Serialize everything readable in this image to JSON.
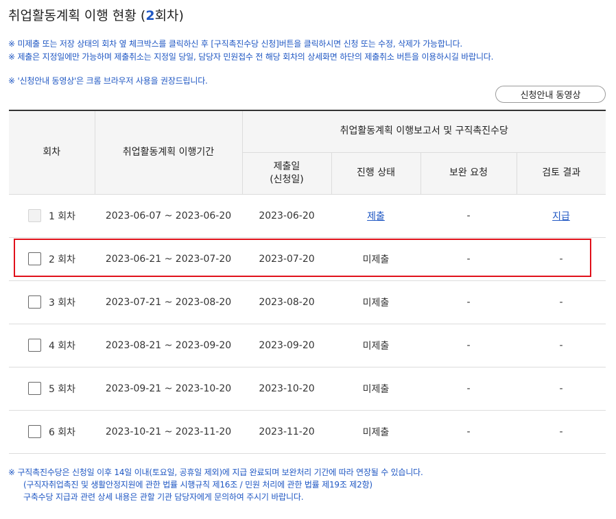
{
  "page": {
    "title_main": "취업활동계획 이행 현황 (",
    "title_round": "2",
    "title_suffix": "회차)"
  },
  "notices": {
    "line1": "※ 미제출 또는 저장 상태의 회차 옆 체크박스를 클릭하신 후 [구직촉진수당 신청]버튼을 클릭하시면 신청 또는 수정, 삭제가 가능합니다.",
    "line2": "※ 제출은 지정일에만 가능하며 제출취소는 지정일 당일, 담당자 민원접수 전 해당 회차의 상세화면 하단의 제출취소 버튼을 이용하시길 바랍니다.",
    "line3": "※ '신청안내 동영상'은 크롬 브라우저 사용을 권장드립니다."
  },
  "video_button": "신청안내 동영상",
  "table": {
    "headers": {
      "round": "회차",
      "period": "취업활동계획 이행기간",
      "group": "취업활동계획 이행보고서 및 구직촉진수당",
      "submit_line1": "제출일",
      "submit_line2": "(신청일)",
      "status": "진행 상태",
      "supplement": "보완 요청",
      "review": "검토 결과"
    },
    "rows": [
      {
        "round": "1 회차",
        "period": "2023-06-07 ~ 2023-06-20",
        "date": "2023-06-20",
        "status": "제출",
        "supplement": "-",
        "review": "지급"
      },
      {
        "round": "2 회차",
        "period": "2023-06-21 ~ 2023-07-20",
        "date": "2023-07-20",
        "status": "미제출",
        "supplement": "-",
        "review": "-"
      },
      {
        "round": "3 회차",
        "period": "2023-07-21 ~ 2023-08-20",
        "date": "2023-08-20",
        "status": "미제출",
        "supplement": "-",
        "review": "-"
      },
      {
        "round": "4 회차",
        "period": "2023-08-21 ~ 2023-09-20",
        "date": "2023-09-20",
        "status": "미제출",
        "supplement": "-",
        "review": "-"
      },
      {
        "round": "5 회차",
        "period": "2023-09-21 ~ 2023-10-20",
        "date": "2023-10-20",
        "status": "미제출",
        "supplement": "-",
        "review": "-"
      },
      {
        "round": "6 회차",
        "period": "2023-10-21 ~ 2023-11-20",
        "date": "2023-11-20",
        "status": "미제출",
        "supplement": "-",
        "review": "-"
      }
    ]
  },
  "footer": {
    "line1": "※ 구직촉진수당은 신청일 이후 14일 이내(토요일, 공휴일 제외)에 지급 완료되며 보완처리 기간에 따라 연장될 수 있습니다.",
    "line2": "(구직자취업촉진 및 생활안정지원에 관한 법률 시행규칙 제16조 / 민원 처리에 관한 법률 제19조 제2항)",
    "line3": "구축수당 지급과 관련 상세 내용은 관할 기관 담당자에게 문의하여 주시기 바랍니다."
  },
  "colors": {
    "accent": "#1f57c3",
    "highlight": "#e0101a"
  }
}
